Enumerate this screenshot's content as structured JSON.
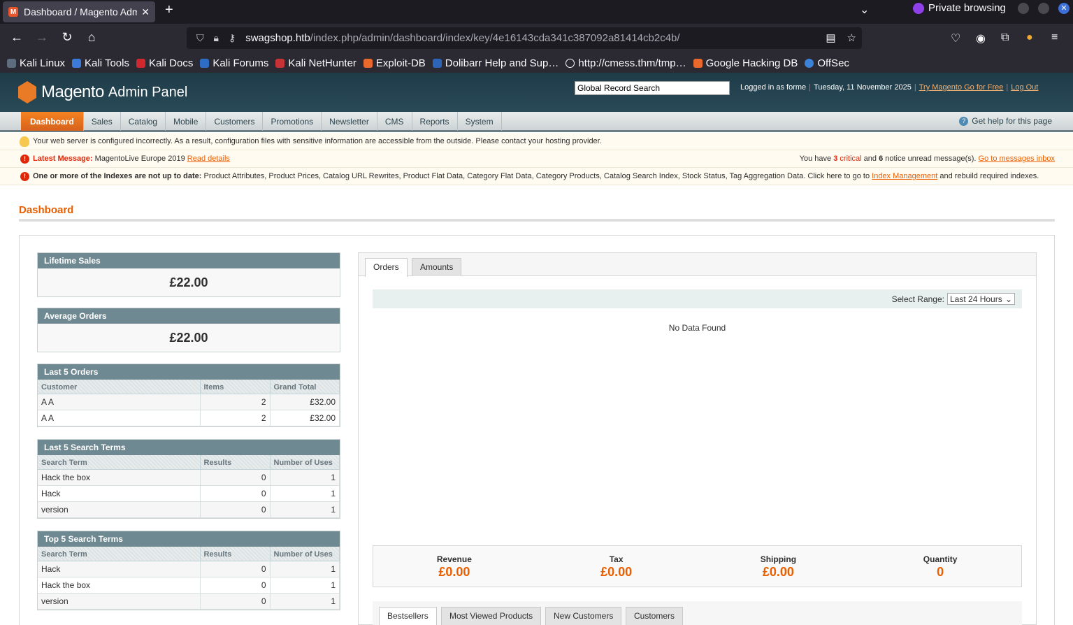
{
  "browser": {
    "tab_title": "Dashboard / Magento Admin",
    "private_label": "Private browsing",
    "url_host": "swagshop.htb",
    "url_path": "/index.php/admin/dashboard/index/key/4e16143cda341c387092a81414cb2c4b/",
    "bookmarks": [
      "Kali Linux",
      "Kali Tools",
      "Kali Docs",
      "Kali Forums",
      "Kali NetHunter",
      "Exploit-DB",
      "Dolibarr Help and Sup…",
      "http://cmess.thm/tmp…",
      "Google Hacking DB",
      "OffSec"
    ]
  },
  "header": {
    "brand": "Magento",
    "sub": "Admin Panel",
    "search_value": "Global Record Search",
    "logged_in": "Logged in as forme",
    "date": "Tuesday, 11 November 2025",
    "try_link": "Try Magento Go for Free",
    "logout": "Log Out"
  },
  "nav": {
    "items": [
      "Dashboard",
      "Sales",
      "Catalog",
      "Mobile",
      "Customers",
      "Promotions",
      "Newsletter",
      "CMS",
      "Reports",
      "System"
    ],
    "help": "Get help for this page"
  },
  "messages": {
    "config_warning": "Your web server is configured incorrectly. As a result, configuration files with sensitive information are accessible from the outside. Please contact your hosting provider.",
    "latest_label": "Latest Message:",
    "latest_text": "MagentoLive Europe 2019",
    "read_details": "Read details",
    "unread_prefix": "You have",
    "critical_count": "3",
    "critical_word": "critical",
    "and_word": "and",
    "notice_count": "6",
    "notice_suffix": "notice unread message(s).",
    "inbox_link": "Go to messages inbox",
    "index_label": "One or more of the Indexes are not up to date:",
    "index_text": "Product Attributes, Product Prices, Catalog URL Rewrites, Product Flat Data, Category Flat Data, Category Products, Catalog Search Index, Stock Status, Tag Aggregation Data. Click here to go to",
    "index_link": "Index Management",
    "index_suffix": "and rebuild required indexes."
  },
  "page": {
    "title": "Dashboard",
    "lifetime_sales_label": "Lifetime Sales",
    "lifetime_sales": "£22.00",
    "avg_orders_label": "Average Orders",
    "avg_orders": "£22.00"
  },
  "last_orders": {
    "title": "Last 5 Orders",
    "columns": [
      "Customer",
      "Items",
      "Grand Total"
    ],
    "rows": [
      [
        "A A",
        "2",
        "£32.00"
      ],
      [
        "A A",
        "2",
        "£32.00"
      ]
    ]
  },
  "last_search": {
    "title": "Last 5 Search Terms",
    "columns": [
      "Search Term",
      "Results",
      "Number of Uses"
    ],
    "rows": [
      [
        "Hack the box",
        "0",
        "1"
      ],
      [
        "Hack",
        "0",
        "1"
      ],
      [
        "version",
        "0",
        "1"
      ]
    ]
  },
  "top_search": {
    "title": "Top 5 Search Terms",
    "columns": [
      "Search Term",
      "Results",
      "Number of Uses"
    ],
    "rows": [
      [
        "Hack",
        "0",
        "1"
      ],
      [
        "Hack the box",
        "0",
        "1"
      ],
      [
        "version",
        "0",
        "1"
      ]
    ]
  },
  "chart_panel": {
    "tabs": [
      "Orders",
      "Amounts"
    ],
    "range_label": "Select Range:",
    "range_value": "Last 24 Hours",
    "no_data": "No Data Found",
    "totals": [
      {
        "label": "Revenue",
        "value": "£0.00"
      },
      {
        "label": "Tax",
        "value": "£0.00"
      },
      {
        "label": "Shipping",
        "value": "£0.00"
      },
      {
        "label": "Quantity",
        "value": "0"
      }
    ],
    "bottom_tabs": [
      "Bestsellers",
      "Most Viewed Products",
      "New Customers",
      "Customers"
    ]
  },
  "colors": {
    "accent": "#eb5e00",
    "nav_active": "#f58220",
    "header_bg": "#1e3b48"
  }
}
